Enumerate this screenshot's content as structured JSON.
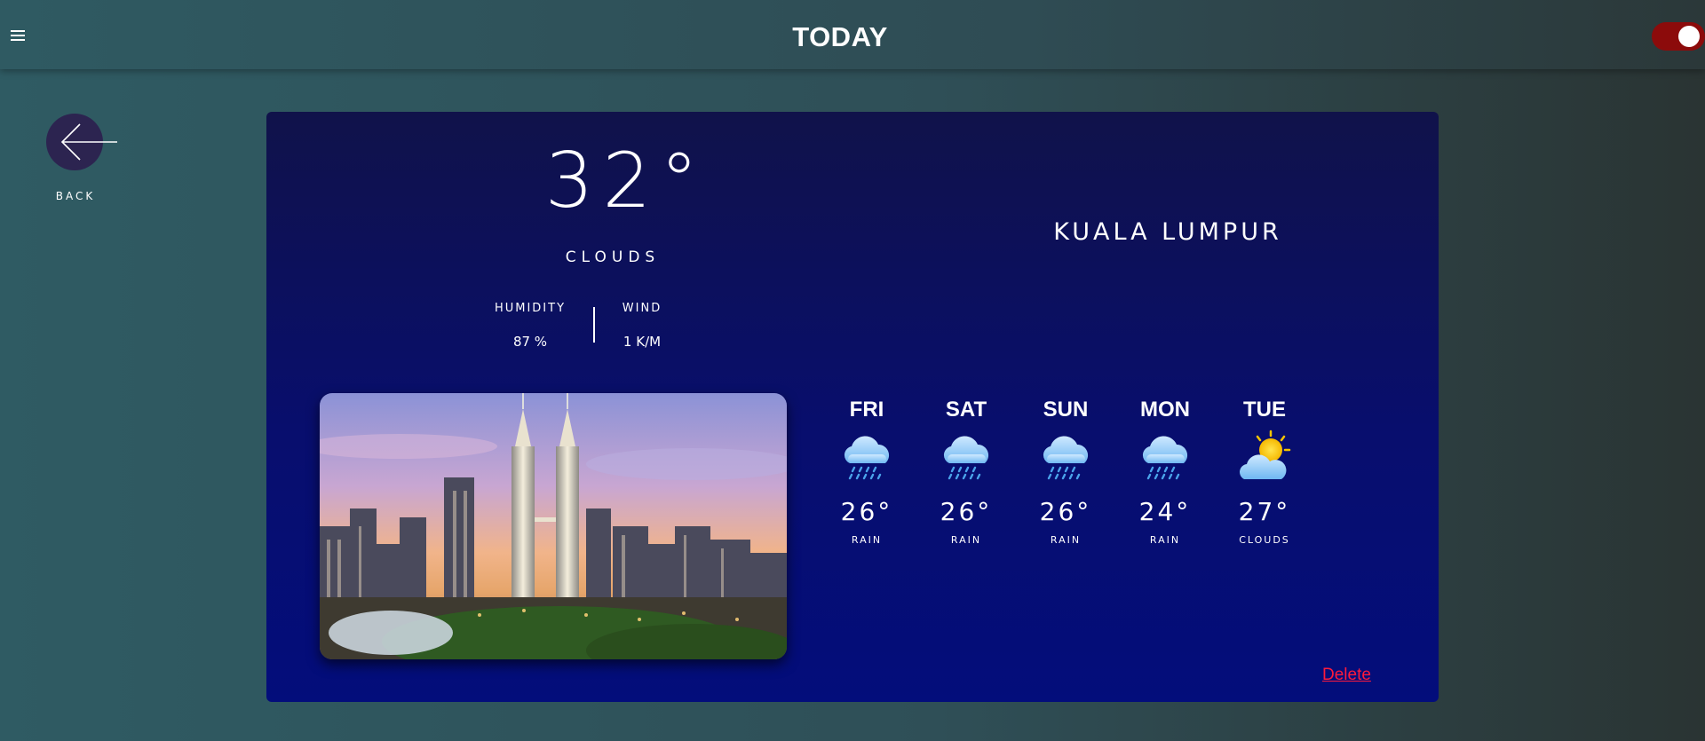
{
  "header": {
    "title": "TODAY",
    "menu_icon": "hamburger-menu-icon",
    "toggle_state": "on",
    "toggle_color": "#8c0b0b"
  },
  "back": {
    "label": "BACK",
    "icon": "arrow-left-icon"
  },
  "current": {
    "temperature": "32°",
    "condition": "CLOUDS",
    "humidity_label": "HUMIDITY",
    "humidity_value": "87 %",
    "wind_label": "WIND",
    "wind_value": "1 K/M",
    "city": "KUALA LUMPUR",
    "photo": "kuala-lumpur-skyline-photo"
  },
  "forecast": [
    {
      "day": "FRI",
      "temp": "26°",
      "condition": "RAIN",
      "icon": "rain-cloud-icon"
    },
    {
      "day": "SAT",
      "temp": "26°",
      "condition": "RAIN",
      "icon": "rain-cloud-icon"
    },
    {
      "day": "SUN",
      "temp": "26°",
      "condition": "RAIN",
      "icon": "rain-cloud-icon"
    },
    {
      "day": "MON",
      "temp": "24°",
      "condition": "RAIN",
      "icon": "rain-cloud-icon"
    },
    {
      "day": "TUE",
      "temp": "27°",
      "condition": "CLOUDS",
      "icon": "sun-cloud-icon"
    }
  ],
  "actions": {
    "delete_label": "Delete",
    "delete_color": "#ff1a3c"
  },
  "colors": {
    "card_top": "#10124a",
    "card_bottom": "#030d7b",
    "back_button": "#2c2450"
  }
}
